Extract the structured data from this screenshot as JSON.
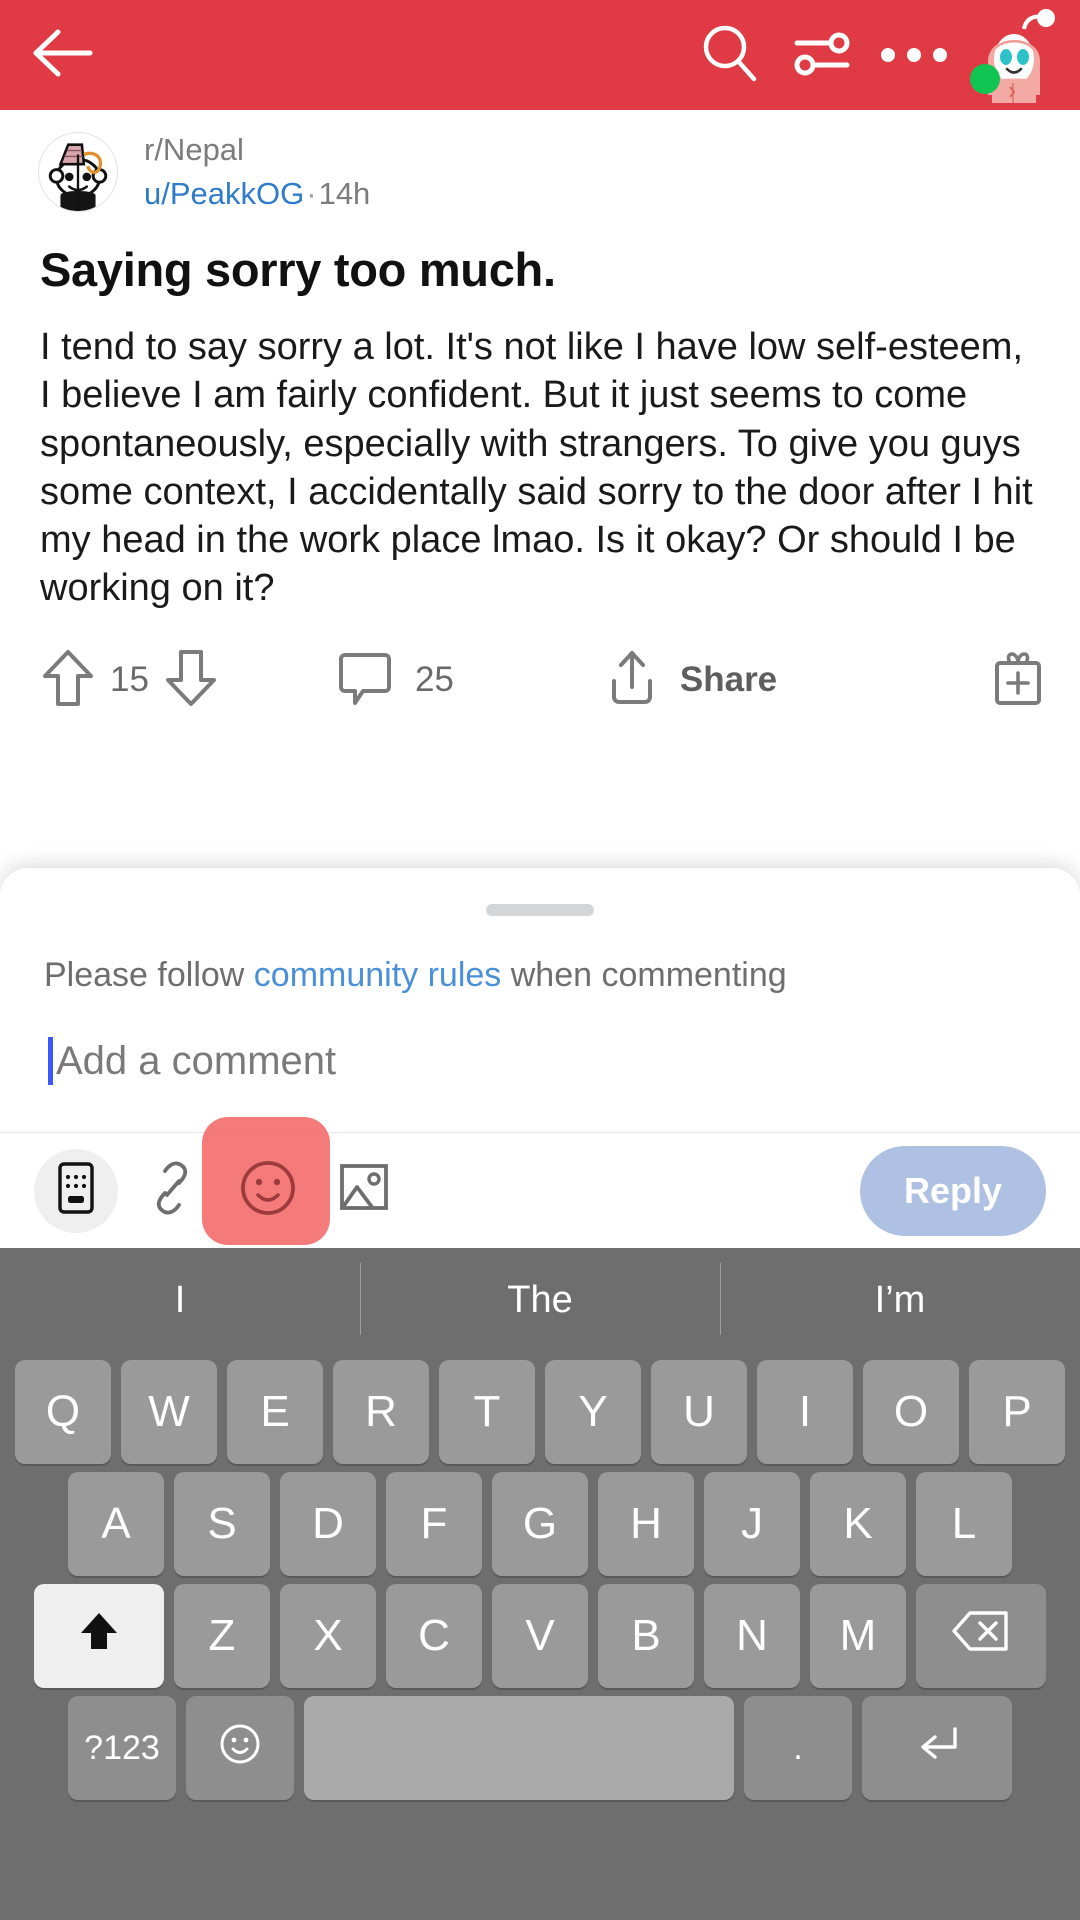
{
  "appbar": {
    "back_icon": "arrow-left-icon",
    "search_icon": "search-icon",
    "sort_icon": "sort-filter-icon",
    "overflow_icon": "more-options-icon",
    "avatar_icon": "user-avatar-snoo",
    "bg_color": "#E03A44",
    "online_status_color": "#12C451"
  },
  "post": {
    "subreddit": "r/Nepal",
    "author": "u/PeakkOG",
    "separator": "·",
    "age": "14h",
    "title": "Saying sorry too much.",
    "body": "I tend to say sorry a lot. It's not like I have low self-esteem, I believe I am fairly confident. But it just seems to come spontaneously, especially with strangers. To give you guys some context, I accidentally said sorry to the door after I hit my head in the work place lmao. Is it okay? Or should I be working on it?",
    "actions": {
      "upvote_icon": "upvote-arrow-icon",
      "score": "15",
      "downvote_icon": "downvote-arrow-icon",
      "comment_icon": "comment-bubble-icon",
      "comment_count": "25",
      "share_icon": "share-icon",
      "share_label": "Share",
      "award_icon": "award-gift-icon"
    }
  },
  "comment_sheet": {
    "grabber": "drag-handle",
    "rules_prefix": "Please follow ",
    "rules_link": "community rules",
    "rules_suffix": " when commenting",
    "input_placeholder": "Add a comment",
    "input_value": "",
    "toolbar": {
      "keyboard_icon": "keyboard-icon",
      "link_icon": "link-icon",
      "emoji_icon": "emoji-smiley-icon",
      "emoji_highlight_color": "#F4706F",
      "image_icon": "image-picker-icon",
      "reply_label": "Reply",
      "reply_bg_color": "#AFC1E3"
    }
  },
  "keyboard": {
    "bg_color": "#6E6E6E",
    "suggestions": [
      "I",
      "The",
      "I’m"
    ],
    "row1": [
      "Q",
      "W",
      "E",
      "R",
      "T",
      "Y",
      "U",
      "I",
      "O",
      "P"
    ],
    "row2": [
      "A",
      "S",
      "D",
      "F",
      "G",
      "H",
      "J",
      "K",
      "L"
    ],
    "row3": {
      "shift_icon": "shift-up-arrow-icon",
      "letters": [
        "Z",
        "X",
        "C",
        "V",
        "B",
        "N",
        "M"
      ],
      "backspace_icon": "backspace-delete-icon"
    },
    "row4": {
      "symbols_label": "?123",
      "emoji_icon": "keyboard-emoji-icon",
      "space_label": "",
      "period_label": ".",
      "enter_icon": "enter-return-icon"
    }
  }
}
